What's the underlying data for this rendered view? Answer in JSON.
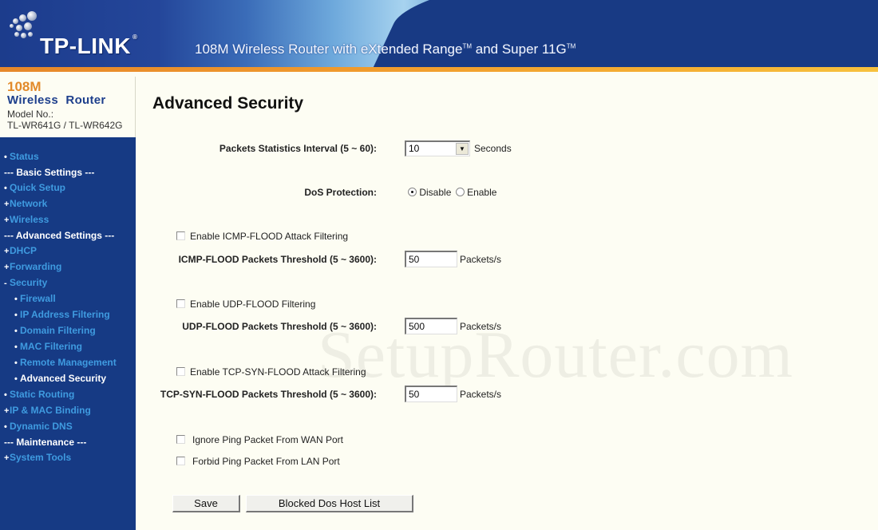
{
  "header": {
    "brand": "TP-LINK",
    "brand_reg": "®",
    "tagline_part1": "108M Wireless Router with eXtended Range",
    "tm1": "TM",
    "tagline_part2": " and Super 11G",
    "tm2": "TM"
  },
  "sidebar": {
    "model_line1": "108M",
    "model_line2": "Wireless Router",
    "model_label": "Model No.:",
    "model_number": "TL-WR641G / TL-WR642G",
    "items": [
      {
        "type": "item",
        "bullet": "•",
        "label": "Status"
      },
      {
        "type": "heading",
        "label": "--- Basic Settings ---"
      },
      {
        "type": "item",
        "bullet": "•",
        "label": "Quick Setup"
      },
      {
        "type": "item",
        "bullet": "+",
        "label": "Network"
      },
      {
        "type": "item",
        "bullet": "+",
        "label": "Wireless"
      },
      {
        "type": "heading",
        "label": "--- Advanced Settings ---"
      },
      {
        "type": "item",
        "bullet": "+",
        "label": "DHCP"
      },
      {
        "type": "item",
        "bullet": "+",
        "label": "Forwarding"
      },
      {
        "type": "item",
        "bullet": "-",
        "label": "Security"
      },
      {
        "type": "sub",
        "bullet": "•",
        "label": "Firewall"
      },
      {
        "type": "sub",
        "bullet": "•",
        "label": "IP Address Filtering"
      },
      {
        "type": "sub",
        "bullet": "•",
        "label": "Domain Filtering"
      },
      {
        "type": "sub",
        "bullet": "•",
        "label": "MAC Filtering"
      },
      {
        "type": "sub",
        "bullet": "•",
        "label": "Remote Management"
      },
      {
        "type": "sub",
        "bullet": "•",
        "label": "Advanced Security",
        "active": true
      },
      {
        "type": "item",
        "bullet": "•",
        "label": "Static Routing"
      },
      {
        "type": "item",
        "bullet": "+",
        "label": "IP & MAC Binding"
      },
      {
        "type": "item",
        "bullet": "•",
        "label": "Dynamic DNS"
      },
      {
        "type": "heading",
        "label": "--- Maintenance ---"
      },
      {
        "type": "item",
        "bullet": "+",
        "label": "System Tools"
      }
    ]
  },
  "main": {
    "title": "Advanced Security",
    "packets_interval": {
      "label": "Packets Statistics Interval (5 ~ 60):",
      "value": "10",
      "unit": "Seconds"
    },
    "dos_protection": {
      "label": "DoS Protection:",
      "options": [
        "Disable",
        "Enable"
      ],
      "selected": "Disable"
    },
    "icmp": {
      "checkbox_label": "Enable ICMP-FLOOD Attack Filtering",
      "checked": false,
      "threshold_label": "ICMP-FLOOD Packets Threshold (5 ~ 3600):",
      "value": "50",
      "unit": "Packets/s"
    },
    "udp": {
      "checkbox_label": "Enable UDP-FLOOD Filtering",
      "checked": false,
      "threshold_label": "UDP-FLOOD Packets Threshold (5 ~ 3600):",
      "value": "500",
      "unit": "Packets/s"
    },
    "tcp": {
      "checkbox_label": "Enable TCP-SYN-FLOOD Attack Filtering",
      "checked": false,
      "threshold_label": "TCP-SYN-FLOOD Packets Threshold (5 ~ 3600):",
      "value": "50",
      "unit": "Packets/s"
    },
    "ping_wan": {
      "label": "Ignore Ping Packet From WAN Port",
      "checked": false
    },
    "ping_lan": {
      "label": "Forbid Ping Packet From LAN Port",
      "checked": false
    },
    "buttons": {
      "save": "Save",
      "blocked_list": "Blocked Dos Host List"
    },
    "watermark": "SetupRouter.com"
  },
  "colors": {
    "header_blue": "#183a84",
    "sidebar_blue": "#163a84",
    "nav_link": "#3f9be0",
    "accent_orange": "#e28a2a",
    "page_bg": "#fdfdf3"
  }
}
